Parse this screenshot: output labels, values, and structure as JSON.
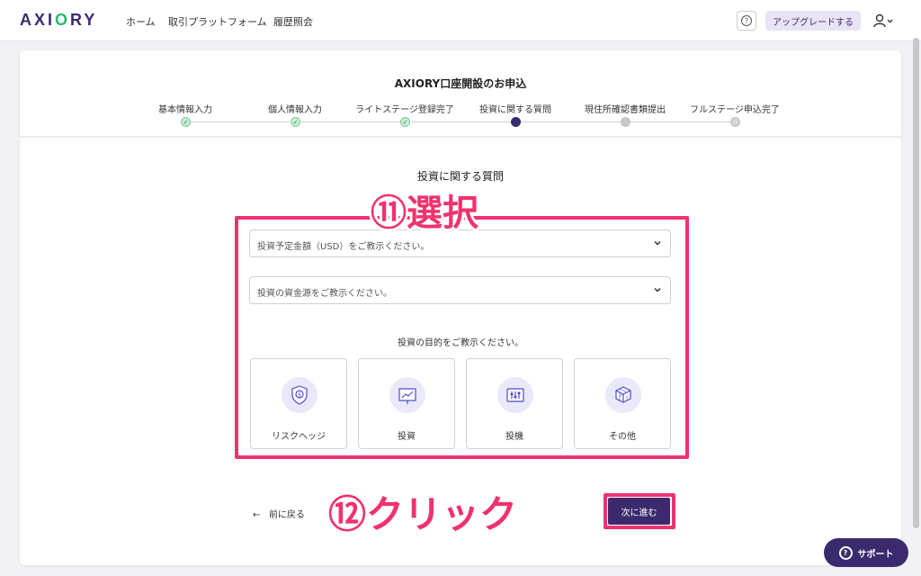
{
  "nav": {
    "logo": "AXIORY",
    "links": [
      "ホーム",
      "取引プラットフォーム",
      "履歴照会"
    ],
    "help_icon": "question-circle-icon",
    "upgrade_label": "アップグレードする",
    "user_icon": "user-chevron-icon"
  },
  "page": {
    "title": "AXIORY口座開設のお申込",
    "steps": [
      {
        "label": "基本情報入力",
        "status": "done"
      },
      {
        "label": "個人情報入力",
        "status": "done"
      },
      {
        "label": "ライトステージ登録完了",
        "status": "done"
      },
      {
        "label": "投資に関する質問",
        "status": "current"
      },
      {
        "label": "現住所確認書類提出",
        "status": "pending"
      },
      {
        "label": "フルステージ申込完了",
        "status": "pending"
      }
    ]
  },
  "form": {
    "section_title": "投資に関する質問",
    "amount_placeholder": "投資予定金額（USD）をご教示ください。",
    "source_placeholder": "投資の資金源をご教示ください。",
    "purpose_label": "投資の目的をご教示ください。",
    "options": [
      {
        "label": "リスクヘッジ",
        "icon": "shield-coin-icon"
      },
      {
        "label": "投資",
        "icon": "chart-board-icon"
      },
      {
        "label": "投機",
        "icon": "sliders-icon"
      },
      {
        "label": "その他",
        "icon": "cube-icon"
      }
    ],
    "back_label": "前に戻る",
    "next_label": "次に進む"
  },
  "annotations": {
    "step11": "⑪選択",
    "step12": "⑫クリック",
    "color": "#f0326e"
  },
  "support": {
    "label": "サポート"
  },
  "colors": {
    "brand": "#3c2a6e",
    "accent": "#2bb673"
  }
}
